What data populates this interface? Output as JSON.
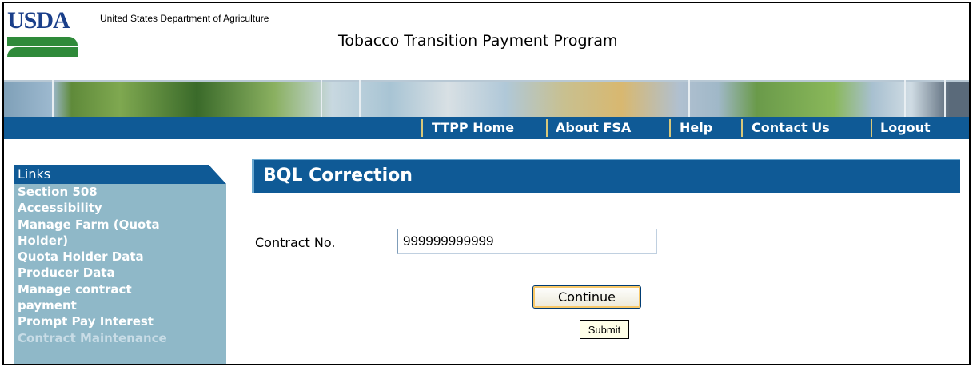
{
  "header": {
    "logo_text": "USDA",
    "department": "United States Department of Agriculture",
    "program_title": "Tobacco Transition Payment Program"
  },
  "nav": {
    "items": [
      "TTPP Home",
      "About FSA",
      "Help",
      "Contact Us",
      "Logout"
    ]
  },
  "sidebar": {
    "title": "Links",
    "items": [
      "Section 508",
      "Accessibility",
      "Manage Farm (Quota",
      "Holder)",
      "Quota Holder Data",
      "Producer Data",
      "Manage contract",
      "payment",
      "Prompt Pay Interest",
      "Contract Maintenance"
    ]
  },
  "main": {
    "page_title": "BQL Correction",
    "contract_label": "Contract No.",
    "contract_value": "999999999999",
    "continue_label": "Continue",
    "submit_label": "Submit"
  },
  "colors": {
    "nav_blue": "#0f5a96",
    "sidebar_bg": "#8fb8c8",
    "usda_blue": "#1a3f8a",
    "usda_green": "#2f8a3a"
  }
}
